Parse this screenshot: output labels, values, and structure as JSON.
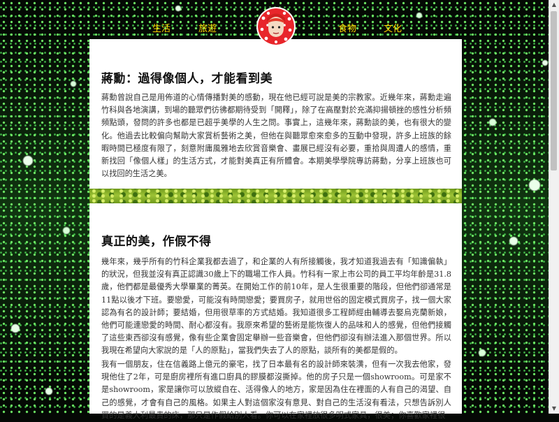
{
  "nav": {
    "items": [
      {
        "label": "生活"
      },
      {
        "label": "旅遊"
      },
      {
        "label": "食物"
      },
      {
        "label": "文化"
      }
    ]
  },
  "article1": {
    "title": "蔣勳：過得像個人，才能看到美",
    "body": "蔣勳曾說自己是用佈道的心情傳播對美的感動，現在他已經可說是美的宗教家。近幾年來，蔣勳走遍竹科與各地演講，到場的聽眾們彷彿都期待受到「開釋」，除了在高壓對於充滿抑揚頓挫的感性分析頻頻點頭，發問的許多也都是已超乎美學的人生之問。事實上，這幾年來，蔣勳談的美，也有很大的變化。他過去比較偏向幫助大家賞析藝術之美，但他在與聽眾愈來愈多的互動中發現，許多上班族的餘暇時間已極度有限了，刻意附庸風雅地去欣賞音樂會、畫展已經沒有必要，重拾與周遭人的感情，重新找回「像個人樣」的生活方式，才能對美真正有所體會。本期美學學院專訪蔣勳，分享上班族也可以找回的生活之美。"
  },
  "article2": {
    "title": "真正的美，作假不得",
    "p1": "幾年來，幾乎所有的竹科企業我都去過了，和企業的人有所接觸後，我才知道我過去有「知識偏執」的狀況，但我並沒有真正認識30歲上下的職場工作人員。竹科有一家上市公司的員工平均年齡是31.8歲，他們都是最優秀大學畢業的菁英。在開始工作的前10年，是人生很重要的階段，但他們卻通常是11點以後才下班。要戀愛，可能沒有時間戀愛；要買房子，就用世俗的固定模式買房子，找一個大家認為有名的設計師；要結婚，但用很草率的方式結婚。我知道很多工程師經由輔導去娶烏克蘭新娘，他們可能連戀愛的時間、耐心都沒有。我原來希望的藝術是能恢復人的品味和人的感覺，但他們接觸了這些東西卻沒有感覺，像有些企業會固定舉辦一些音樂會，但他們卻沒有辦法進入那個世界。所以我現在希望向大家說的是「人的原點」，當我們失去了人的原點，談所有的美都是假的。",
    "p2": "我有一個朋友，住在信義路上億元的豪宅，找了日本最有名的設計師來裝潢，但有一次我去他家，發現他住了2年，可是廚房裡所有進口廚具的膠膜都沒撕掉。他的房子只是一個showroom。可是家不是showroom，家是讓你可以放縱自在、活得像人的地方，家是因為住在裡面的人有自己的渴望、自己的感覺，才會有自己的風格。如果主人對這個家沒有意見、對自己的生活沒有看法，只想告訴別人買的是義大利最貴的床，那只是作假給別人看。你可以在家裡放很多明式家具，很美；你喜歡家裡很"
  },
  "colors": {
    "nav_text": "#ffd400",
    "band_green": "#8ab82a"
  },
  "icons": {
    "logo": "polka-dot-portrait-logo"
  }
}
